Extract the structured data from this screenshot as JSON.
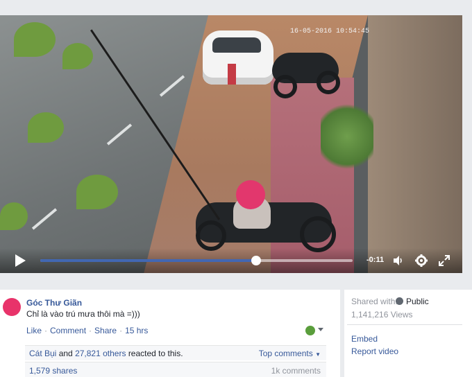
{
  "video": {
    "timestamp": "16-05-2016 10:54:45",
    "progress": 0.69,
    "time_left": "-0:11",
    "icons": {
      "play": "play-icon",
      "volume": "volume-icon",
      "settings": "gear-icon",
      "fullscreen": "fullscreen-icon"
    }
  },
  "post": {
    "author": "Góc Thư Giãn",
    "message": "Chỉ là vào trú mưa thôi mà =)))",
    "actions": {
      "like": "Like",
      "comment": "Comment",
      "share": "Share",
      "time": "15 hrs"
    },
    "reactions": {
      "first_name": "Cát Bụi",
      "and": "and",
      "others": "27,821 others",
      "suffix": "reacted to this.",
      "top_comments": "Top comments"
    },
    "stats": {
      "shares": "1,579 shares",
      "comments": "1k comments"
    }
  },
  "side": {
    "shared_with_label": "Shared with:",
    "privacy": "Public",
    "views": "1,141,216 Views",
    "embed": "Embed",
    "report": "Report video"
  },
  "colors": {
    "link": "#365899",
    "progress": "#4267b2",
    "avatar": "#e8336a"
  }
}
